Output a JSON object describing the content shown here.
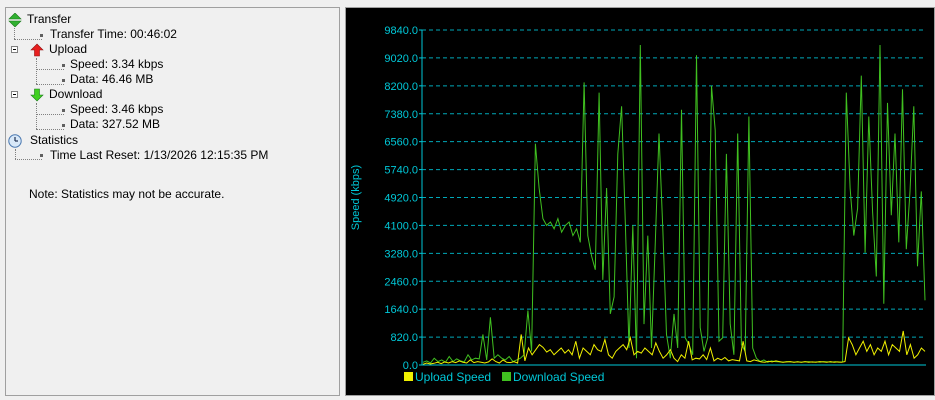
{
  "tree": {
    "transfer": {
      "label": "Transfer",
      "transfer_time": "Transfer Time: 00:46:02"
    },
    "upload": {
      "label": "Upload",
      "speed": "Speed: 3.34 kbps",
      "data": "Data: 46.46 MB"
    },
    "download": {
      "label": "Download",
      "speed": "Speed: 3.46 kbps",
      "data": "Data: 327.52 MB"
    },
    "statistics": {
      "label": "Statistics",
      "time_last_reset": "Time Last Reset: 1/13/2026 12:15:35 PM"
    }
  },
  "note": "Note: Statistics may not be accurate.",
  "colors": {
    "upload": "#f0f000",
    "download": "#40c020",
    "axis_text": "#00c8d8",
    "grid": "#00a8b8"
  },
  "chart_data": {
    "type": "line",
    "ylabel": "Speed (kbps)",
    "ylim": [
      0,
      9840
    ],
    "yticks": [
      "0.0",
      "820.0",
      "1640.0",
      "2460.0",
      "3280.0",
      "4100.0",
      "4920.0",
      "5740.0",
      "6560.0",
      "7380.0",
      "8200.0",
      "9020.0",
      "9840.0"
    ],
    "grid": true,
    "legend_position": "bottom",
    "series": [
      {
        "name": "Upload Speed",
        "values": [
          20,
          60,
          30,
          50,
          80,
          40,
          90,
          60,
          100,
          70,
          120,
          80,
          60,
          150,
          70,
          100,
          80,
          60,
          90,
          180,
          100,
          60,
          150,
          80,
          70,
          100,
          60,
          900,
          120,
          500,
          300,
          450,
          600,
          520,
          380,
          450,
          300,
          400,
          500,
          350,
          450,
          300,
          700,
          200,
          500,
          400,
          300,
          600,
          450,
          400,
          750,
          300,
          200,
          400,
          500,
          600,
          450,
          800,
          300,
          400,
          350,
          500,
          400,
          300,
          650,
          400,
          200,
          300,
          450,
          200,
          100,
          300,
          200,
          700,
          150,
          200,
          180,
          300,
          160,
          500,
          120,
          200,
          150,
          220,
          120,
          160,
          140,
          120,
          700,
          120,
          100,
          150,
          120,
          90,
          80,
          110,
          90,
          120,
          100,
          80,
          90,
          100,
          80,
          90,
          80,
          100,
          80,
          90,
          80,
          100,
          90,
          80,
          100,
          80,
          90,
          80,
          100,
          800,
          600,
          300,
          500,
          700,
          400,
          600,
          300,
          500,
          400,
          700,
          300,
          600,
          500,
          400,
          1000,
          300,
          600,
          200,
          300,
          500,
          400
        ],
        "color": "#f0f000"
      },
      {
        "name": "Download Speed",
        "values": [
          80,
          120,
          60,
          200,
          100,
          150,
          80,
          250,
          100,
          180,
          120,
          90,
          300,
          150,
          200,
          180,
          900,
          150,
          1400,
          200,
          300,
          200,
          150,
          250,
          100,
          150,
          200,
          300,
          1600,
          400,
          6500,
          5200,
          4300,
          4100,
          4200,
          4000,
          4300,
          3900,
          4100,
          4200,
          3800,
          4000,
          3600,
          8300,
          3800,
          3200,
          2800,
          8000,
          2500,
          5200,
          1500,
          2000,
          6200,
          7600,
          4200,
          500,
          4100,
          200,
          9400,
          1200,
          3800,
          500,
          3600,
          6800,
          4000,
          900,
          200,
          1500,
          500,
          7500,
          800,
          600,
          300,
          9100,
          1100,
          400,
          800,
          8200,
          6900,
          700,
          800,
          6200,
          1200,
          300,
          6800,
          600,
          400,
          7300,
          500,
          200,
          100,
          150,
          80,
          120,
          100,
          90,
          80,
          100,
          90,
          80,
          100,
          80,
          90,
          100,
          80,
          90,
          80,
          100,
          90,
          80,
          100,
          80,
          90,
          8000,
          5200,
          3800,
          4600,
          8500,
          3300,
          7300,
          4500,
          2600,
          9400,
          1800,
          7700,
          4400,
          6800,
          3600,
          8100,
          3400,
          5100,
          7600,
          2900,
          5100,
          1900
        ],
        "color": "#40c020"
      }
    ]
  }
}
